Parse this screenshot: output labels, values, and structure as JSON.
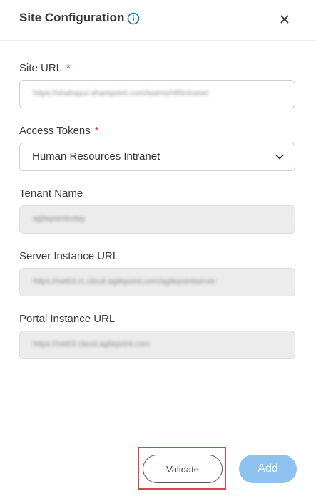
{
  "header": {
    "title": "Site Configuration"
  },
  "fields": {
    "site_url": {
      "label": "Site URL",
      "required_mark": "*",
      "value": "https://shahapur.sharepoint.com/teams/HRIntranet"
    },
    "access_tokens": {
      "label": "Access Tokens",
      "required_mark": "*",
      "value": "Human Resources Intranet"
    },
    "tenant_name": {
      "label": "Tenant Name",
      "value": "agilepointinday"
    },
    "server_instance_url": {
      "label": "Server Instance URL",
      "value": "https://net03.rc.cloud.agilepoint.com/agilepointserver"
    },
    "portal_instance_url": {
      "label": "Portal Instance URL",
      "value": "https://net03.cloud.agilepoint.com"
    }
  },
  "footer": {
    "validate_label": "Validate",
    "add_label": "Add"
  },
  "colors": {
    "accent": "#1a73c7",
    "required": "#d9363e",
    "add_button": "#8ec2f0",
    "highlight": "#e0443e",
    "readonly_bg": "#ececec"
  },
  "icons": {
    "info": "info-icon",
    "close": "close-icon",
    "dropdown": "chevron-down-icon"
  }
}
